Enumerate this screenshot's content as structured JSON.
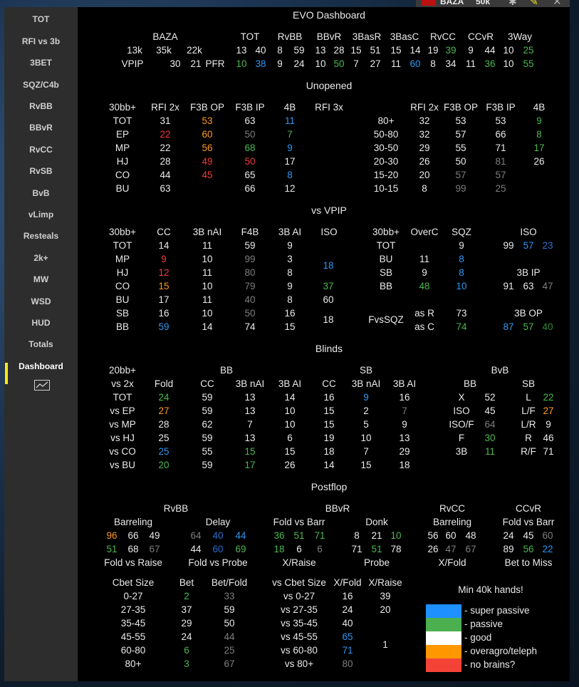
{
  "window": {
    "title_fragment": "BAZA",
    "stakes": "50k"
  },
  "colors": {
    "super_passive": "#1e90ff",
    "passive": "#4caf50",
    "good": "#ffffff",
    "overagro": "#ff9800",
    "no_brains": "#f44336"
  },
  "sidebar": {
    "items": [
      "TOT",
      "RFI vs 3b",
      "3BET",
      "SQZ/C4b",
      "RvBB",
      "BBvR",
      "RvCC",
      "RvSB",
      "BvB",
      "vLimp",
      "Resteals",
      "2k+",
      "MW",
      "WSD",
      "HUD",
      "Totals",
      "Dashboard"
    ],
    "active": "Dashboard",
    "chart_icon": "chart-icon"
  },
  "title": "EVO Dashboard",
  "headers": {
    "unopened": "Unopened",
    "vs_vpip": "vs VPIP",
    "blinds": "Blinds",
    "postflop": "Postflop"
  },
  "summary": {
    "baza": "BAZA",
    "row1": [
      "13k",
      "35k",
      "22k"
    ],
    "row2": [
      "VPIP",
      "30",
      "21",
      "PFR"
    ],
    "cols": [
      "TOT",
      "RvBB",
      "BBvR",
      "3BasR",
      "3BasC",
      "RvCC",
      "CCvR",
      "3Way"
    ],
    "vals1": [
      "13",
      "40",
      "8",
      "59",
      "13",
      "28",
      "15",
      "51",
      "15",
      "14",
      "19",
      "39",
      "9",
      "44",
      "10",
      "25"
    ],
    "vals2": [
      "10",
      "38",
      "9",
      "24",
      "10",
      "50",
      "7",
      "27",
      "11",
      "60",
      "8",
      "34",
      "11",
      "36",
      "10",
      "55"
    ]
  },
  "unopened": {
    "left_headers": [
      "30bb+",
      "RFI 2x",
      "F3B OP",
      "F3B IP",
      "4B",
      "RFI 3x"
    ],
    "left_rows": [
      [
        "TOT",
        "31",
        "53",
        "63",
        "11"
      ],
      [
        "EP",
        "22",
        "60",
        "50",
        "7"
      ],
      [
        "MP",
        "22",
        "56",
        "68",
        "9"
      ],
      [
        "HJ",
        "28",
        "49",
        "50",
        "17"
      ],
      [
        "CO",
        "44",
        "45",
        "65",
        "8"
      ],
      [
        "BU",
        "63",
        "",
        "66",
        "12"
      ]
    ],
    "right_headers": [
      "RFI 2x",
      "F3B OP",
      "F3B IP",
      "4B"
    ],
    "right_rows": [
      [
        "80+",
        "32",
        "53",
        "53",
        "9"
      ],
      [
        "50-80",
        "32",
        "57",
        "66",
        "8"
      ],
      [
        "30-50",
        "29",
        "55",
        "71",
        "17"
      ],
      [
        "20-30",
        "26",
        "50",
        "81",
        "26"
      ],
      [
        "15-20",
        "20",
        "57",
        "57",
        ""
      ],
      [
        "10-15",
        "8",
        "99",
        "25",
        ""
      ]
    ]
  },
  "vs_vpip": {
    "left_headers": [
      "30bb+",
      "CC",
      "3B nAI",
      "F4B",
      "3B AI",
      "ISO"
    ],
    "left_rows": [
      [
        "TOT",
        "14",
        "11",
        "59",
        "9"
      ],
      [
        "MP",
        "9",
        "10",
        "99",
        "3"
      ],
      [
        "HJ",
        "12",
        "11",
        "80",
        "8"
      ],
      [
        "CO",
        "15",
        "10",
        "79",
        "9"
      ],
      [
        "BU",
        "17",
        "11",
        "40",
        "8"
      ],
      [
        "SB",
        "16",
        "10",
        "50",
        "16"
      ],
      [
        "BB",
        "59",
        "14",
        "74",
        "15"
      ]
    ],
    "iso_vals": [
      "18",
      "37",
      "60",
      "18"
    ],
    "mid_headers": [
      "30bb+",
      "OverC",
      "SQZ"
    ],
    "mid_rows": [
      [
        "TOT",
        "",
        "9"
      ],
      [
        "BU",
        "11",
        "8"
      ],
      [
        "SB",
        "9",
        "8"
      ],
      [
        "BB",
        "48",
        "10"
      ]
    ],
    "fvs_sqz": {
      "label": "FvsSQZ",
      "as_r": "as R",
      "as_r_val": "73",
      "as_c": "as C",
      "as_c_val": "74"
    },
    "right": {
      "iso": "ISO",
      "iso_vals": [
        "99",
        "57",
        "23"
      ],
      "ip": "3B IP",
      "ip_vals": [
        "91",
        "63",
        "47"
      ],
      "op": "3B OP",
      "op_vals": [
        "87",
        "57",
        "40"
      ]
    }
  },
  "blinds": {
    "group_bb": "BB",
    "group_sb": "SB",
    "group_bvb": "BvB",
    "headers": [
      "20bb+",
      "vs 2x",
      "Fold",
      "CC",
      "3B nAI",
      "3B AI",
      "CC",
      "3B nAI",
      "3B AI"
    ],
    "rows": [
      [
        "TOT",
        "24",
        "59",
        "13",
        "14",
        "16",
        "9",
        "16"
      ],
      [
        "vs EP",
        "27",
        "59",
        "13",
        "10",
        "15",
        "2",
        "7"
      ],
      [
        "vs MP",
        "28",
        "62",
        "7",
        "10",
        "15",
        "5",
        "9"
      ],
      [
        "vs HJ",
        "25",
        "59",
        "13",
        "6",
        "19",
        "10",
        "13"
      ],
      [
        "vs CO",
        "25",
        "55",
        "15",
        "15",
        "18",
        "7",
        "29"
      ],
      [
        "vs BU",
        "20",
        "59",
        "17",
        "26",
        "14",
        "15",
        "18"
      ]
    ],
    "bvb_headers": [
      "BB",
      "SB"
    ],
    "bvb_rows": [
      [
        "X",
        "52",
        "L",
        "22"
      ],
      [
        "ISO",
        "45",
        "L/F",
        "27"
      ],
      [
        "ISO/F",
        "64",
        "L/R",
        "9"
      ],
      [
        "F",
        "30",
        "R",
        "46"
      ],
      [
        "3B",
        "11",
        "R/F",
        "71"
      ]
    ]
  },
  "postflop": {
    "rvbb": "RvBB",
    "bbvr": "BBvR",
    "rvcc": "RvCC",
    "ccvr": "CCvR",
    "sub": [
      "Barreling",
      "Delay",
      "Fold vs Barr",
      "Donk",
      "Barreling",
      "Fold vs Barr"
    ],
    "barreling": [
      [
        "96",
        "66",
        "49"
      ],
      [
        "51",
        "68",
        "67"
      ]
    ],
    "delay": [
      [
        "64",
        "40",
        "44"
      ],
      [
        "44",
        "60",
        "69"
      ]
    ],
    "fvb": [
      [
        "36",
        "51",
        "71"
      ],
      [
        "18",
        "6",
        "6"
      ]
    ],
    "donk": [
      [
        "8",
        "21",
        "10"
      ],
      [
        "71",
        "51",
        "78"
      ]
    ],
    "rvcc_vals": [
      [
        "56",
        "60",
        "48"
      ],
      [
        "26",
        "47",
        "67"
      ]
    ],
    "ccvr_vals": [
      [
        "24",
        "45",
        "60"
      ],
      [
        "89",
        "56",
        "22"
      ]
    ],
    "foot": [
      "Fold vs Raise",
      "Fold vs Probe",
      "X/Raise",
      "Probe",
      "X/Fold",
      "Bet to Miss"
    ],
    "cbet_headers": [
      "Cbet Size",
      "Bet",
      "Bet/Fold"
    ],
    "cbet_rows": [
      [
        "0-27",
        "2",
        "33"
      ],
      [
        "27-35",
        "37",
        "59"
      ],
      [
        "35-45",
        "29",
        "50"
      ],
      [
        "45-55",
        "24",
        "44"
      ],
      [
        "60-80",
        "6",
        "25"
      ],
      [
        "80+",
        "3",
        "67"
      ]
    ],
    "vscbet_headers": [
      "vs Cbet Size",
      "X/Fold",
      "X/Raise"
    ],
    "vscbet_rows": [
      [
        "vs 0-27",
        "16",
        "39"
      ],
      [
        "vs 27-35",
        "24",
        "20"
      ],
      [
        "vs 35-45",
        "40",
        ""
      ],
      [
        "vs 45-55",
        "65",
        ""
      ],
      [
        "vs 60-80",
        "71",
        "1"
      ],
      [
        "vs 80+",
        "80",
        ""
      ]
    ]
  },
  "legend": {
    "title": "Min 40k hands!",
    "items": [
      "- super passive",
      "- passive",
      "- good",
      "- overagro/teleph",
      "- no brains?"
    ]
  }
}
